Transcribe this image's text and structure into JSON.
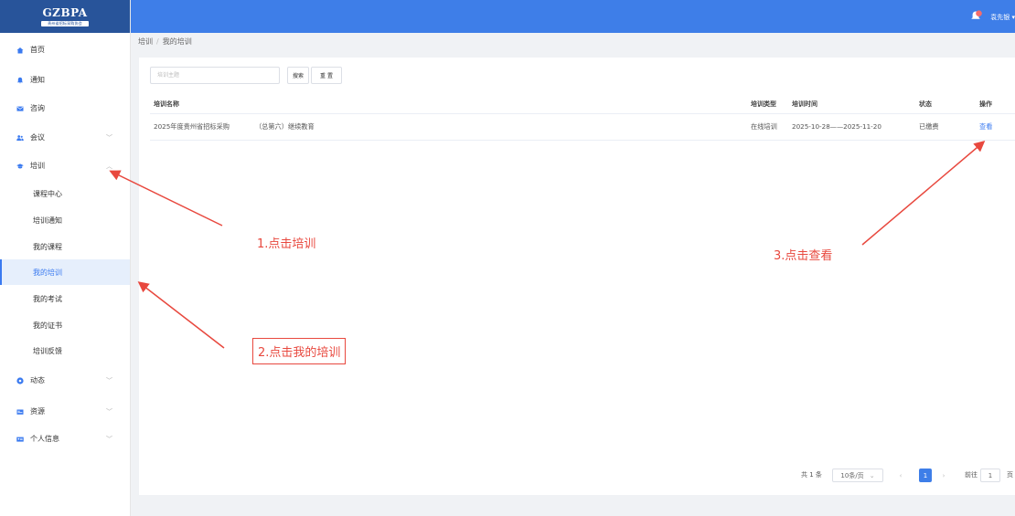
{
  "logo": {
    "title": "GZBPA",
    "subtitle": "贵州省招标采购协会"
  },
  "header": {
    "user_name": "袁先银",
    "notification_count": "1"
  },
  "sidebar": {
    "items": [
      {
        "label": "首页",
        "icon": "home-icon"
      },
      {
        "label": "通知",
        "icon": "bell-icon"
      },
      {
        "label": "咨询",
        "icon": "mail-icon"
      },
      {
        "label": "会议",
        "icon": "people-icon",
        "expandable": true
      },
      {
        "label": "培训",
        "icon": "graduation-cap-icon",
        "expandable": true,
        "expanded": true
      },
      {
        "label": "动态",
        "icon": "compass-icon",
        "expandable": true
      },
      {
        "label": "资源",
        "icon": "folder-icon",
        "expandable": true
      },
      {
        "label": "个人信息",
        "icon": "id-card-icon",
        "expandable": true
      }
    ],
    "sub_items": [
      "课程中心",
      "培训通知",
      "我的课程",
      "我的培训",
      "我的考试",
      "我的证书",
      "培训反馈"
    ],
    "active_sub_item": "我的培训"
  },
  "breadcrumb": {
    "parent": "培训",
    "separator": "/",
    "current": "我的培训"
  },
  "search": {
    "placeholder": "培训主题",
    "search_label": "搜索",
    "reset_label": "重 置"
  },
  "table": {
    "headers": [
      "培训名称",
      "培训类型",
      "培训时间",
      "状态",
      "操作"
    ],
    "rows": [
      {
        "name_start": "2025年度贵州省招标采购",
        "name_end": "（总第六）继续教育",
        "type": "在线培训",
        "time": "2025-10-28——2025-11-20",
        "status": "已缴费",
        "action": "查看"
      }
    ]
  },
  "pagination": {
    "total": "共 1 条",
    "page_size": "10条/页",
    "current_page": "1",
    "goto_label": "前往",
    "goto_value": "1",
    "page_suffix": "页"
  },
  "annotations": {
    "step1": "1.点击培训",
    "step2": "2.点击我的培训",
    "step3": "3.点击查看"
  },
  "colors": {
    "accent": "#3e7ee8",
    "sidebar_logo": "#28549a",
    "annotation": "#e8483e",
    "active_bg": "#e6effc"
  }
}
